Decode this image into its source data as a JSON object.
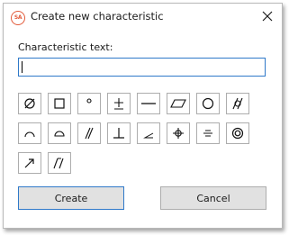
{
  "window": {
    "icon_label": "SA",
    "title": "Create new characteristic",
    "close_glyph": "×"
  },
  "form": {
    "label": "Characteristic text:",
    "value": "",
    "placeholder": ""
  },
  "symbols": [
    {
      "name": "diameter-symbol",
      "glyph": "Ø"
    },
    {
      "name": "square-symbol",
      "glyph": "□"
    },
    {
      "name": "degree-symbol",
      "glyph": "°"
    },
    {
      "name": "plus-minus-symbol",
      "glyph": "±"
    },
    {
      "name": "straightness-symbol",
      "glyph": "—"
    },
    {
      "name": "flatness-symbol",
      "glyph": "▱"
    },
    {
      "name": "circularity-symbol",
      "glyph": "○"
    },
    {
      "name": "cylindricity-symbol",
      "glyph": "⌭"
    },
    {
      "name": "profile-of-line-symbol",
      "glyph": "⌒"
    },
    {
      "name": "profile-of-surface-symbol",
      "glyph": "⌓"
    },
    {
      "name": "parallelism-symbol",
      "glyph": "∥"
    },
    {
      "name": "perpendicularity-symbol",
      "glyph": "⊥"
    },
    {
      "name": "angularity-symbol",
      "glyph": "∠"
    },
    {
      "name": "position-symbol",
      "glyph": "⌖"
    },
    {
      "name": "symmetry-symbol",
      "glyph": "⌯"
    },
    {
      "name": "concentricity-symbol",
      "glyph": "◎"
    },
    {
      "name": "circular-runout-symbol",
      "glyph": "↗"
    },
    {
      "name": "total-runout-symbol",
      "glyph": "⌰"
    }
  ],
  "buttons": {
    "create": "Create",
    "cancel": "Cancel"
  },
  "colors": {
    "accent": "#2f79c9",
    "icon_accent": "#e25a3a",
    "button_face": "#e1e1e1",
    "border": "#adadad"
  }
}
